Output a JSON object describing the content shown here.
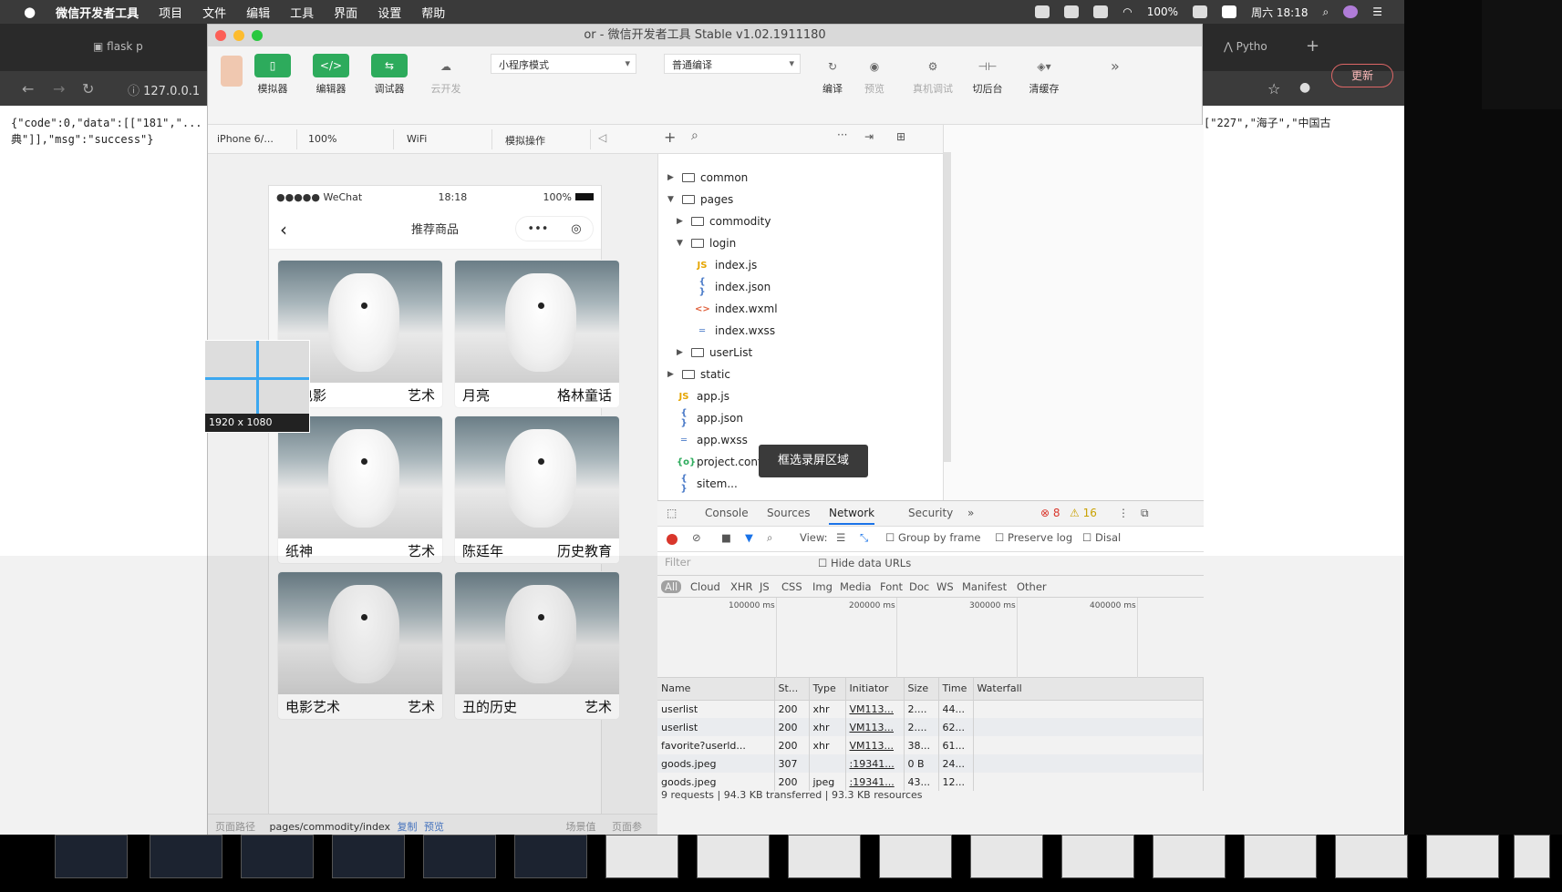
{
  "menubar": {
    "app_name": "微信开发者工具",
    "items": [
      "项目",
      "文件",
      "编辑",
      "工具",
      "界面",
      "设置",
      "帮助"
    ],
    "battery": "100%",
    "clock": "周六 18:18"
  },
  "browser": {
    "tab1": "flask p",
    "tab2": "Pytho",
    "address": "127.0.0.1",
    "update_label": "更新",
    "json_left": "{\"code\":0,\"data\":[[\"181\",\"... 典\"]],\"msg\":\"success\"}",
    "json_right": "[\"227\",\"海子\",\"中国古"
  },
  "devtools": {
    "title": "or - 微信开发者工具 Stable v1.02.1911180",
    "toolbar": {
      "simulator": "模拟器",
      "editor": "编辑器",
      "debugger": "调试器",
      "cloud": "云开发",
      "mode": "小程序模式",
      "compile_mode": "普通编译",
      "compile": "编译",
      "preview": "预览",
      "remote_debug": "真机调试",
      "backend": "切后台",
      "clear_cache": "清缓存"
    },
    "subbar": {
      "device": "iPhone 6/...",
      "zoom": "100%",
      "network": "WiFi",
      "operation": "模拟操作"
    },
    "phone": {
      "carrier": "●●●●● WeChat",
      "time": "18:18",
      "battery": "100%",
      "nav_title": "推荐商品",
      "cards": [
        {
          "title": "的电影",
          "tag": "艺术"
        },
        {
          "title": "月亮",
          "tag": "格林童话"
        },
        {
          "title": "纸神",
          "tag": "艺术"
        },
        {
          "title": "陈廷年",
          "tag": "历史教育"
        },
        {
          "title": "电影艺术",
          "tag": "艺术"
        },
        {
          "title": "丑的历史",
          "tag": "艺术"
        }
      ]
    },
    "tree": {
      "common": "common",
      "pages": "pages",
      "commodity": "commodity",
      "login": "login",
      "index_js": "index.js",
      "index_json": "index.json",
      "index_wxml": "index.wxml",
      "index_wxss": "index.wxss",
      "userList": "userList",
      "static": "static",
      "app_js": "app.js",
      "app_json": "app.json",
      "app_wxss": "app.wxss",
      "project_config": "project.config.json",
      "sitemap": "sitem..."
    },
    "panel": {
      "tabs": [
        "Console",
        "Sources",
        "Network",
        "Security"
      ],
      "errors": "8",
      "warnings": "16",
      "view_label": "View:",
      "group_by_frame": "Group by frame",
      "preserve_log": "Preserve log",
      "disable": "Disal",
      "filter_placeholder": "Filter",
      "hide_data_urls": "Hide data URLs",
      "types": [
        "All",
        "Cloud",
        "XHR",
        "JS",
        "CSS",
        "Img",
        "Media",
        "Font",
        "Doc",
        "WS",
        "Manifest",
        "Other"
      ],
      "timeline": [
        "100000 ms",
        "200000 ms",
        "300000 ms",
        "400000 ms"
      ],
      "columns": [
        "Name",
        "St...",
        "Type",
        "Initiator",
        "Size",
        "Time",
        "Waterfall"
      ],
      "rows": [
        {
          "name": "userlist",
          "status": "200",
          "type": "xhr",
          "initiator": "VM113...",
          "size": "2....",
          "time": "44..."
        },
        {
          "name": "userlist",
          "status": "200",
          "type": "xhr",
          "initiator": "VM113...",
          "size": "2....",
          "time": "62..."
        },
        {
          "name": "favorite?userld...",
          "status": "200",
          "type": "xhr",
          "initiator": "VM113...",
          "size": "38...",
          "time": "61..."
        },
        {
          "name": "goods.jpeg",
          "status": "307",
          "type": "",
          "initiator": ":19341...",
          "size": "0 B",
          "time": "24..."
        },
        {
          "name": "goods.jpeg",
          "status": "200",
          "type": "jpeg",
          "initiator": ":19341...",
          "size": "43...",
          "time": "12..."
        }
      ],
      "summary": "9 requests | 94.3 KB transferred | 93.3 KB resources"
    },
    "pathbar": {
      "label": "页面路径",
      "path": "pages/commodity/index",
      "copy": "复制",
      "preview": "预览",
      "scene": "场景值",
      "params": "页面参数"
    }
  },
  "capture": {
    "size_label": "1920 x 1080",
    "tooltip": "框选录屏区域"
  }
}
